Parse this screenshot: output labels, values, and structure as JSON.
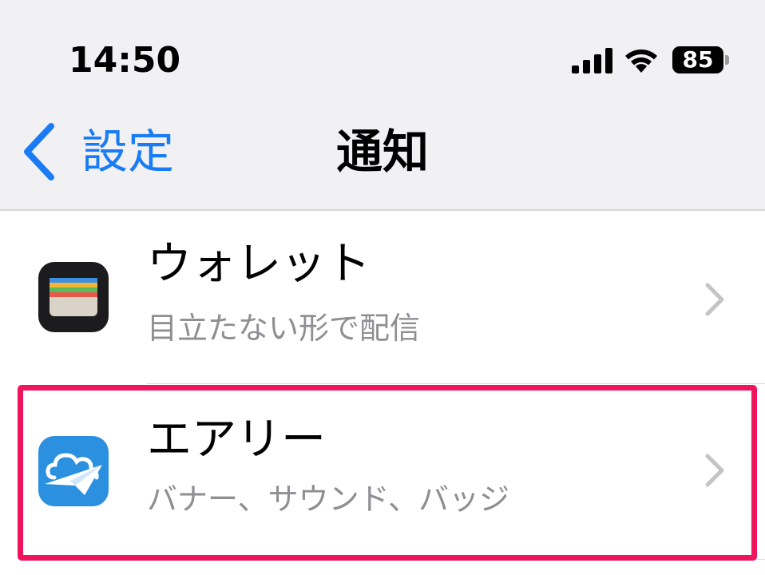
{
  "status_bar": {
    "time": "14:50",
    "battery_percent": "85",
    "signal_icon": "cellular-signal-icon",
    "wifi_icon": "wifi-icon"
  },
  "nav": {
    "back_label": "設定",
    "title": "通知",
    "back_icon": "chevron-left-icon",
    "accent_color": "#1a7cf5"
  },
  "list": {
    "items": [
      {
        "app_name": "ウォレット",
        "subtitle": "目立たない形で配信",
        "icon": "wallet-app-icon"
      },
      {
        "app_name": "エアリー",
        "subtitle": "バナー、サウンド、バッジ",
        "icon": "airy-app-icon"
      }
    ]
  },
  "highlight": {
    "color": "#f0145f",
    "target": "エアリー"
  }
}
